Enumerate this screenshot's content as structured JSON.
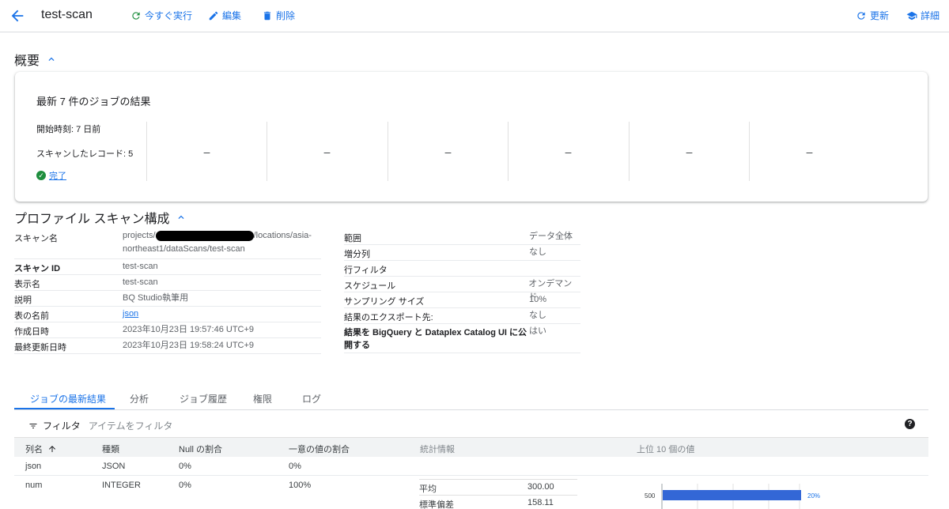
{
  "header": {
    "title": "test-scan",
    "run_now": "今すぐ実行",
    "edit": "編集",
    "delete": "削除",
    "refresh": "更新",
    "details": "詳細"
  },
  "overview": {
    "heading": "概要",
    "card_title": "最新 7 件のジョブの結果",
    "start_time": "開始時刻: 7 日前",
    "records": "スキャンしたレコード:  5",
    "status": "完了",
    "empty_runs": [
      "–",
      "–",
      "–",
      "–",
      "–",
      "–"
    ]
  },
  "config": {
    "heading": "プロファイル スキャン構成",
    "left": [
      {
        "k": "スキャン名",
        "v_pre": "projects/",
        "v_post": "/locations/asia-northeast1/dataScans/test-scan"
      },
      {
        "k": "スキャン ID",
        "v": "test-scan"
      },
      {
        "k": "表示名",
        "v": "test-scan"
      },
      {
        "k": "説明",
        "v": "BQ Studio執筆用"
      },
      {
        "k": "表の名前",
        "v": "json"
      },
      {
        "k": "作成日時",
        "v": "2023年10月23日 19:57:46 UTC+9"
      },
      {
        "k": "最終更新日時",
        "v": "2023年10月23日 19:58:24 UTC+9"
      }
    ],
    "right": [
      {
        "k": "範囲",
        "v": "データ全体"
      },
      {
        "k": "増分列",
        "v": "なし"
      },
      {
        "k": "行フィルタ",
        "v": ""
      },
      {
        "k": "スケジュール",
        "v": "オンデマンド"
      },
      {
        "k": "サンプリング サイズ",
        "v": "10%"
      },
      {
        "k": "結果のエクスポート先:",
        "v": "なし"
      },
      {
        "k": "結果を BigQuery と Dataplex Catalog UI に公開する",
        "v": "はい"
      }
    ]
  },
  "tabs": [
    "ジョブの最新結果",
    "分析",
    "ジョブ履歴",
    "権限",
    "ログ"
  ],
  "filter": {
    "label": "フィルタ",
    "placeholder": "アイテムをフィルタ"
  },
  "table": {
    "headers": [
      "列名",
      "種類",
      "Null の割合",
      "一意の値の割合",
      "統計情報",
      "上位 10 個の値"
    ],
    "rows": [
      {
        "name": "json",
        "type": "JSON",
        "null": "0%",
        "unique": "0%"
      },
      {
        "name": "num",
        "type": "INTEGER",
        "null": "0%",
        "unique": "100%"
      }
    ],
    "stats": [
      {
        "label": "平均",
        "value": "300.00"
      },
      {
        "label": "標準偏差",
        "value": "158.11"
      }
    ],
    "top_values": [
      {
        "value": "500",
        "percent": "20%",
        "fraction": 0.2
      }
    ]
  },
  "colors": {
    "accent": "#1a73e8",
    "success": "#1e8e3e",
    "bar": "#3367d6"
  }
}
